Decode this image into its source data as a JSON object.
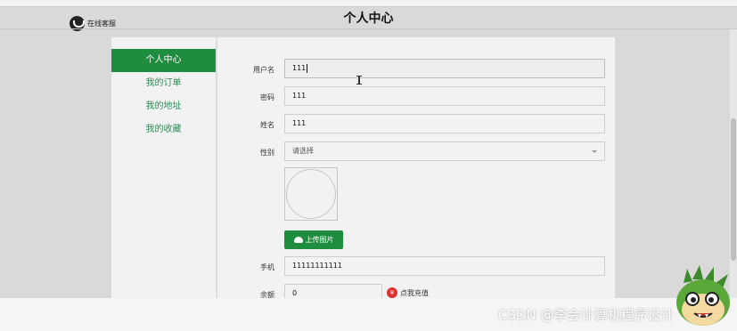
{
  "header": {
    "title": "个人中心"
  },
  "service": {
    "label": "在线客服"
  },
  "sidebar": {
    "items": [
      {
        "label": "个人中心"
      },
      {
        "label": "我的订单"
      },
      {
        "label": "我的地址"
      },
      {
        "label": "我的收藏"
      }
    ]
  },
  "form": {
    "username": {
      "label": "用户名",
      "value": "111"
    },
    "password": {
      "label": "密码",
      "value": "111"
    },
    "name": {
      "label": "姓名",
      "value": "111"
    },
    "gender": {
      "label": "性别",
      "placeholder": "请选择"
    },
    "upload": {
      "label": "上传图片"
    },
    "phone": {
      "label": "手机",
      "value": "11111111111"
    },
    "balance": {
      "label": "余额",
      "value": "0"
    },
    "recharge": {
      "label": "点我充值",
      "icon": "¥"
    }
  },
  "watermark": "CSDN @李会计算机程序设计",
  "colors": {
    "accent": "#1e8e3e",
    "recharge": "#e03030"
  }
}
